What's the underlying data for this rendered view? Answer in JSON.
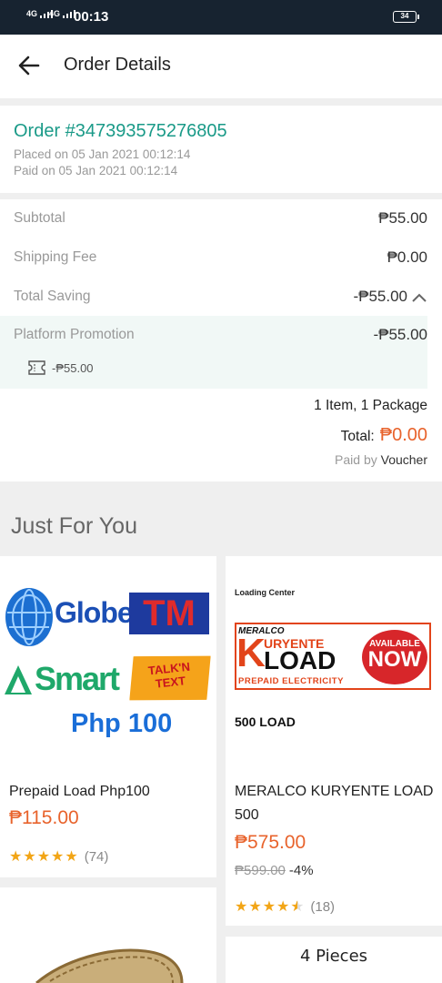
{
  "status_bar": {
    "signal_1": "4G",
    "signal_2": "4G",
    "time": "00:13",
    "battery": "34"
  },
  "header": {
    "title": "Order Details"
  },
  "order": {
    "id": "Order #347393575276805",
    "placed": "Placed on 05 Jan 2021  00:12:14",
    "paid": "Paid on 05 Jan 2021  00:12:14"
  },
  "summary": {
    "subtotal_label": "Subtotal",
    "subtotal_value": "₱55.00",
    "shipping_label": "Shipping Fee",
    "shipping_value": "₱0.00",
    "saving_label": "Total Saving",
    "saving_value": "-₱55.00",
    "promo_label": "Platform Promotion",
    "promo_value": "-₱55.00",
    "voucher_amount": "-₱55.00",
    "items_packages": "1 Item, 1 Package",
    "total_label": "Total:",
    "total_value": "₱0.00",
    "paid_by_label": "Paid by",
    "paid_by_method": "Voucher"
  },
  "just_for_you": {
    "title": "Just For You",
    "products": [
      {
        "name": "Prepaid Load Php100",
        "price": "₱115.00",
        "rating_count": "(74)",
        "rating": 5,
        "image_text": {
          "globe": "Globe",
          "tm": "TM",
          "smart": "Smart",
          "talk_n_text_1": "TALK'N",
          "talk_n_text_2": "TEXT",
          "php": "Php 100"
        }
      },
      {
        "name": "MERALCO KURYENTE LOAD 500",
        "price": "₱575.00",
        "old_price": "₱599.00",
        "discount": "-4%",
        "rating_count": "(18)",
        "rating": 4.5,
        "image_text": {
          "loading_center": "Loading Center",
          "meralco": "MERALCO",
          "kuryente_k": "K",
          "kuryente": "URYENTE",
          "load": "LOAD",
          "prepaid": "PREPAID ELECTRICITY",
          "available": "AVAILABLE",
          "now": "NOW",
          "load_500": "500 LOAD"
        }
      },
      {
        "name": "",
        "image_text": {}
      },
      {
        "name": "",
        "image_text": {
          "pieces": "4 Pieces"
        }
      }
    ]
  },
  "colors": {
    "accent": "#1a9a88",
    "price": "#e8632c",
    "status_bar": "#172330",
    "star": "#f2a516"
  }
}
